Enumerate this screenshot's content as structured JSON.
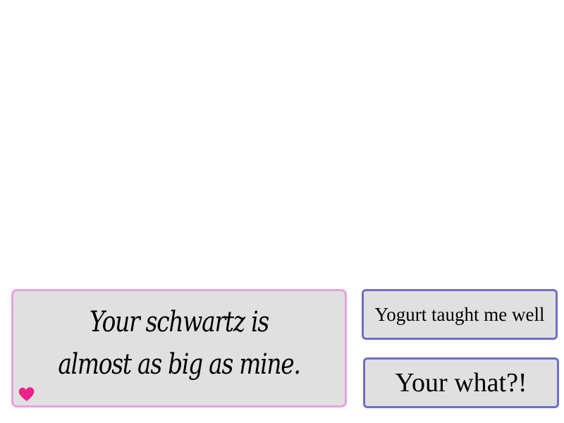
{
  "dialogue": {
    "text": "Your schwartz is\nalmost as big as mine.",
    "box_color": "#e0e0e0",
    "border_color": "#e8a0e0",
    "indicator_icon": "heart-icon",
    "indicator_color": "#ee2288"
  },
  "choices": [
    {
      "label": "Yogurt taught me well"
    },
    {
      "label": "Your what?!"
    }
  ],
  "choice_border_color": "#6e6ec8"
}
